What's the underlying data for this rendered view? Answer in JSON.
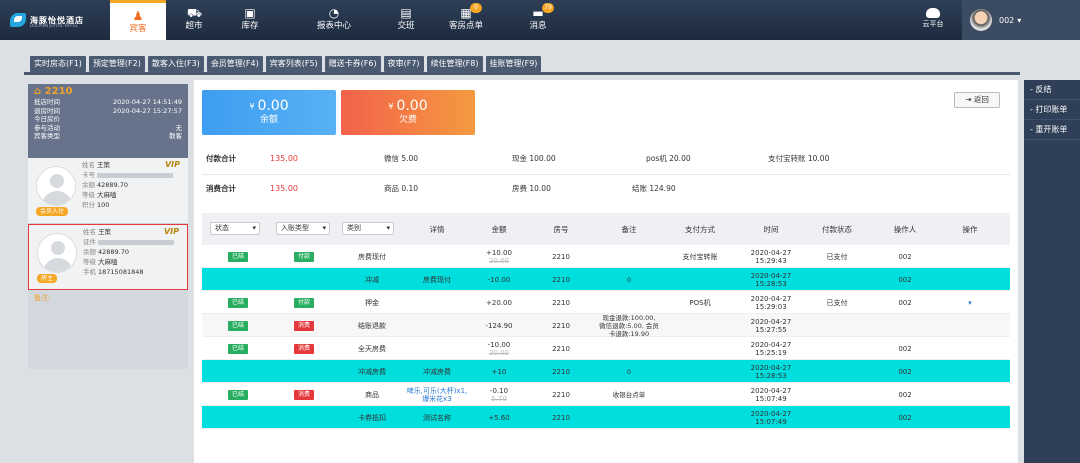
{
  "brand": {
    "name": "海豚怡悦酒店",
    "sub": "DOLPHIN JOYFUL HOTEL"
  },
  "nav": [
    {
      "label": "宾客",
      "icon": "guests-icon",
      "active": true
    },
    {
      "label": "超市",
      "icon": "cart-icon"
    },
    {
      "label": "库存",
      "icon": "box-icon"
    },
    {
      "label": "报表中心",
      "icon": "pie-chart-icon"
    },
    {
      "label": "交班",
      "icon": "handover-icon"
    },
    {
      "label": "客房点单",
      "icon": "room-order-icon",
      "badge": "0"
    },
    {
      "label": "消息",
      "icon": "message-icon",
      "badge": "79"
    }
  ],
  "cloud": {
    "label": "云平台"
  },
  "user": {
    "name": "002"
  },
  "tabs": [
    "实时房态(F1)",
    "预定管理(F2)",
    "散客入住(F3)",
    "会员管理(F4)",
    "宾客列表(F5)",
    "赠送卡券(F6)",
    "夜审(F7)",
    "续住管理(F8)",
    "挂账管理(F9)"
  ],
  "room": {
    "number": "2210",
    "rows": [
      {
        "k": "抵店时间",
        "v": "2020-04-27 14:51:49"
      },
      {
        "k": "退房时间",
        "v": "2020-04-27 15:27:57"
      },
      {
        "k": "今日房价",
        "v": ""
      },
      {
        "k": "参与活动",
        "v": "无"
      },
      {
        "k": "宾客类型",
        "v": "散客"
      }
    ]
  },
  "guests": [
    {
      "name": "王策",
      "id_label": "卡号",
      "balance": "42889.70",
      "level": "大麻嗑",
      "extra_label": "积分",
      "extra": "100",
      "tag": "会员入住"
    },
    {
      "name": "王策",
      "id_label": "证件",
      "balance": "42889.70",
      "level": "大麻嗑",
      "extra_label": "手机",
      "extra": "18715081848",
      "tag": "房主"
    }
  ],
  "labels": {
    "name": "姓名",
    "balance": "余额",
    "level": "等级",
    "vip": "VIP",
    "note": "备注:",
    "currency": "¥"
  },
  "right_actions": [
    "- 反结",
    "- 打印账单",
    "- 重开账单"
  ],
  "cards": {
    "balance": {
      "value": "0.00",
      "label": "余额"
    },
    "owe": {
      "value": "0.00",
      "label": "欠费"
    }
  },
  "back_label": "返回",
  "summary": {
    "pay": {
      "label": "付款合计",
      "total": "135.00",
      "items": [
        "微信 5.00",
        "现金 100.00",
        "pos机 20.00",
        "支付宝转账 10.00"
      ]
    },
    "cost": {
      "label": "消费合计",
      "total": "135.00",
      "items": [
        "商品 0.10",
        "房费 10.00",
        "结账 124.90"
      ]
    }
  },
  "filters": {
    "status": "状态",
    "entry_type": "入账类型",
    "category": "类别"
  },
  "columns": [
    "详情",
    "金额",
    "房号",
    "备注",
    "支付方式",
    "时间",
    "付款状态",
    "操作人",
    "操作"
  ],
  "rows": [
    {
      "status": "已结",
      "type": "付款",
      "type_color": "#27ae60",
      "category": "房费现付",
      "detail": "",
      "amount": "+10.00",
      "amount_old": "20.00",
      "room": "2210",
      "note": "",
      "pay": "支付宝转账",
      "date": "2020-04-27",
      "time": "15:29:43",
      "pstatus": "已支付",
      "op": "002",
      "hl": false,
      "act": ""
    },
    {
      "status": "",
      "type": "",
      "type_color": "",
      "category": "冲减",
      "detail": "房费现付",
      "amount": "-10.00",
      "amount_old": "",
      "room": "2210",
      "note": "0",
      "pay": "",
      "date": "2020-04-27",
      "time": "15:28:53",
      "pstatus": "",
      "op": "002",
      "hl": true,
      "act": ""
    },
    {
      "status": "已结",
      "type": "付款",
      "type_color": "#27ae60",
      "category": "押金",
      "detail": "",
      "amount": "+20.00",
      "amount_old": "",
      "room": "2210",
      "note": "",
      "pay": "POS机",
      "date": "2020-04-27",
      "time": "15:29:03",
      "pstatus": "已支付",
      "op": "002",
      "hl": false,
      "act": "▾"
    },
    {
      "status": "已结",
      "type": "消费",
      "type_color": "#e4393c",
      "category": "结账退款",
      "detail": "",
      "amount": "-124.90",
      "amount_old": "",
      "room": "2210",
      "note": "现金退款:100.00,\n微信退款:5.00, 会员\n卡退款:19.90",
      "pay": "",
      "date": "2020-04-27",
      "time": "15:27:55",
      "pstatus": "",
      "op": "",
      "hl": false,
      "act": ""
    },
    {
      "status": "已结",
      "type": "消费",
      "type_color": "#e4393c",
      "category": "全天房费",
      "detail": "",
      "amount": "-10.00",
      "amount_old": "20.00",
      "room": "2210",
      "note": "",
      "pay": "",
      "date": "2020-04-27",
      "time": "15:25:19",
      "pstatus": "",
      "op": "002",
      "hl": false,
      "act": ""
    },
    {
      "status": "",
      "type": "",
      "type_color": "",
      "category": "冲减房费",
      "detail": "冲减房费",
      "amount": "+10",
      "amount_old": "",
      "room": "2210",
      "note": "0",
      "pay": "",
      "date": "2020-04-27",
      "time": "15:28:53",
      "pstatus": "",
      "op": "002",
      "hl": true,
      "act": ""
    },
    {
      "status": "已结",
      "type": "消费",
      "type_color": "#e4393c",
      "category": "商品",
      "detail": "啤乐,可乐(大杯)x1,\n爆米花x3",
      "amount": "-0.10",
      "amount_old": "5.70",
      "room": "2210",
      "note": "收银台点单",
      "pay": "",
      "date": "2020-04-27",
      "time": "15:07:49",
      "pstatus": "",
      "op": "002",
      "hl": false,
      "act": ""
    },
    {
      "status": "",
      "type": "",
      "type_color": "",
      "category": "卡券抵扣",
      "detail": "测试名称",
      "amount": "+5.60",
      "amount_old": "",
      "room": "2210",
      "note": "",
      "pay": "",
      "date": "2020-04-27",
      "time": "15:07:49",
      "pstatus": "",
      "op": "002",
      "hl": true,
      "act": ""
    }
  ]
}
